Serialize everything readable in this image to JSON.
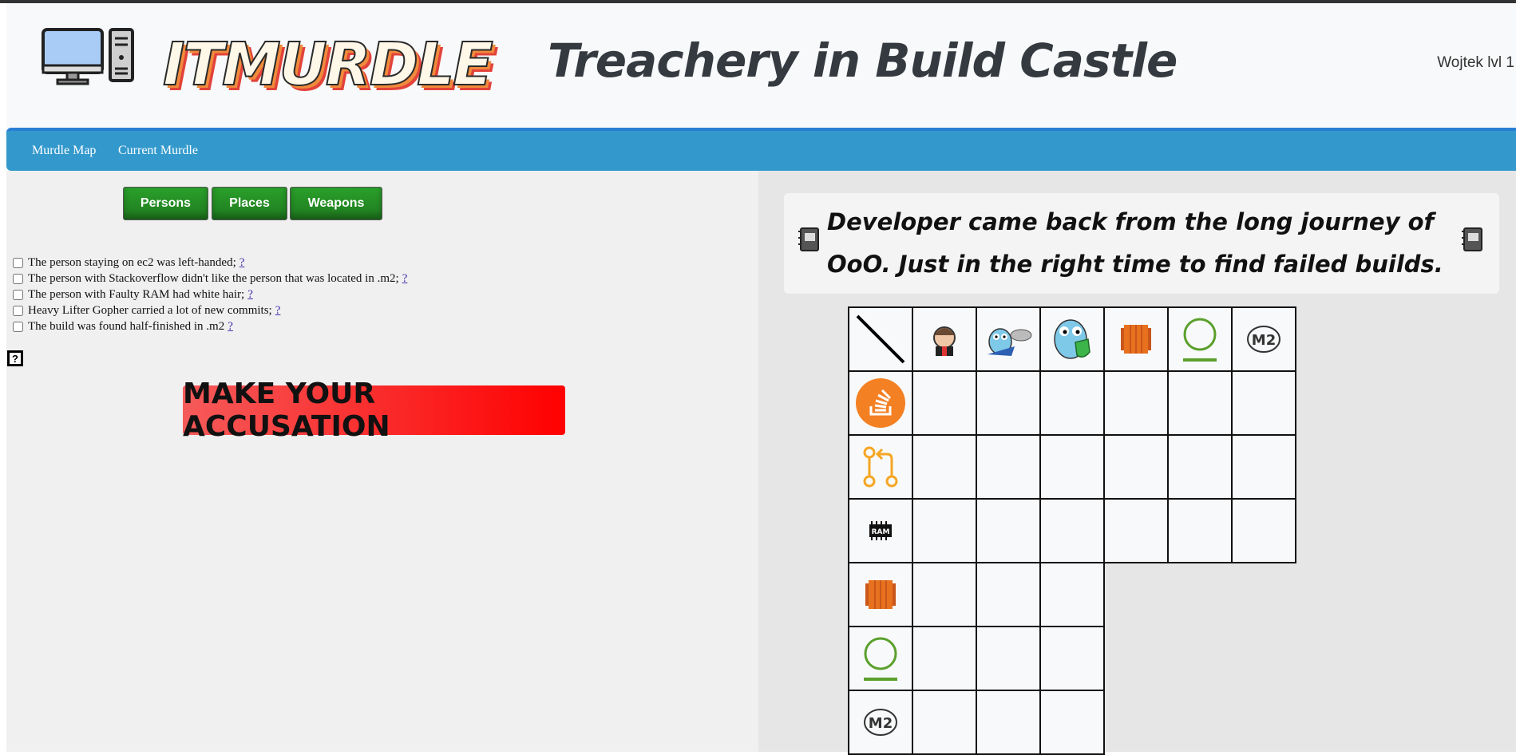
{
  "header": {
    "logo_text": "ITMURDLE",
    "title": "Treachery in Build Castle",
    "user": "Wojtek lvl 1"
  },
  "nav": {
    "items": [
      "Murdle Map",
      "Current Murdle"
    ]
  },
  "tabs": [
    "Persons",
    "Places",
    "Weapons"
  ],
  "clues": [
    {
      "text": "The person staying on ec2 was left-handed;",
      "hint": "?"
    },
    {
      "text": "The person with Stackoverflow didn't like the person that was located in .m2;",
      "hint": "?"
    },
    {
      "text": "The person with Faulty RAM had white hair;",
      "hint": "?"
    },
    {
      "text": "Heavy Lifter Gopher carried a lot of new commits;",
      "hint": "?"
    },
    {
      "text": "The build was found half-finished in .m2",
      "hint": "?"
    }
  ],
  "help_label": "?",
  "accuse_label": "MAKE YOUR ACCUSATION",
  "story": "Developer came back from the long journey of OoO. Just in the right time to find failed builds.",
  "grid": {
    "column_icons": [
      "jenkins-icon",
      "gopher-cloud-icon",
      "gopher-shield-icon",
      "aws-ec2-icon",
      "circle-underline-icon",
      "m2-icon"
    ],
    "row_icons": [
      "stackoverflow-icon",
      "git-pull-request-icon",
      "ram-chip-icon",
      "aws-ec2-icon",
      "circle-underline-icon",
      "m2-icon"
    ],
    "colors": {
      "orange": "#f48024",
      "green": "#5aa02c",
      "ec2": "#e8711f"
    }
  }
}
